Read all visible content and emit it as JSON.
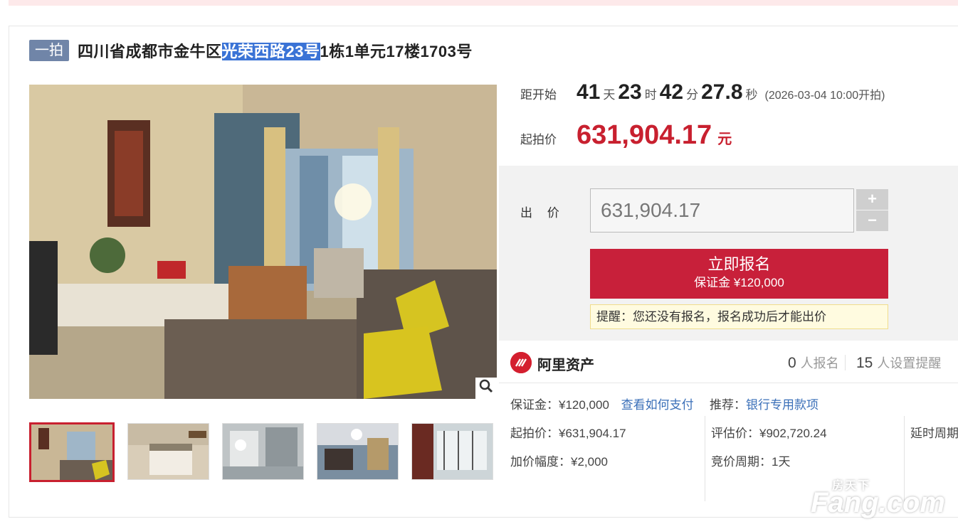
{
  "header": {
    "tag": "一拍",
    "title_prefix": "四川省成都市金牛区",
    "title_highlight": "光荣西路23号",
    "title_suffix": "1栋1单元17楼1703号"
  },
  "countdown": {
    "label": "距开始",
    "days": "41",
    "days_unit": "天",
    "hours": "23",
    "hours_unit": "时",
    "minutes": "42",
    "minutes_unit": "分",
    "seconds": "27.8",
    "seconds_unit": "秒",
    "start_note": "(2026-03-04 10:00开拍)"
  },
  "start_price": {
    "label": "起拍价",
    "value": "631,904.17",
    "unit": "元"
  },
  "bid": {
    "label": "出 价",
    "input_value": "631,904.17",
    "plus": "+",
    "minus": "−",
    "signup_main": "立即报名",
    "signup_sub": "保证金 ¥120,000",
    "notice": "提醒：您还没有报名，报名成功后才能出价"
  },
  "brand": {
    "name": "阿里资产",
    "signup_count": "0",
    "signup_label": "人报名",
    "reminder_count": "15",
    "reminder_label": "人设置提醒"
  },
  "details": {
    "deposit": "保证金：¥120,000",
    "pay_link": "查看如何支付",
    "recommend": "推荐：",
    "recommend_link": "银行专用款项",
    "start_price": "起拍价：¥631,904.17",
    "appraisal": "评估价：¥902,720.24",
    "delay_period": "延时周期",
    "increment": "加价幅度：¥2,000",
    "auction_period": "竞价周期：1天"
  },
  "gallery": {
    "zoom_icon": "magnifier-icon",
    "thumbnail_count": 5
  },
  "watermark": {
    "text": "Fang.com",
    "cn": "房天下"
  },
  "colors": {
    "accent_red": "#c8202f",
    "tag_blue": "#7085a8",
    "highlight_blue": "#3a73d6",
    "link_blue": "#3a6fb8"
  }
}
